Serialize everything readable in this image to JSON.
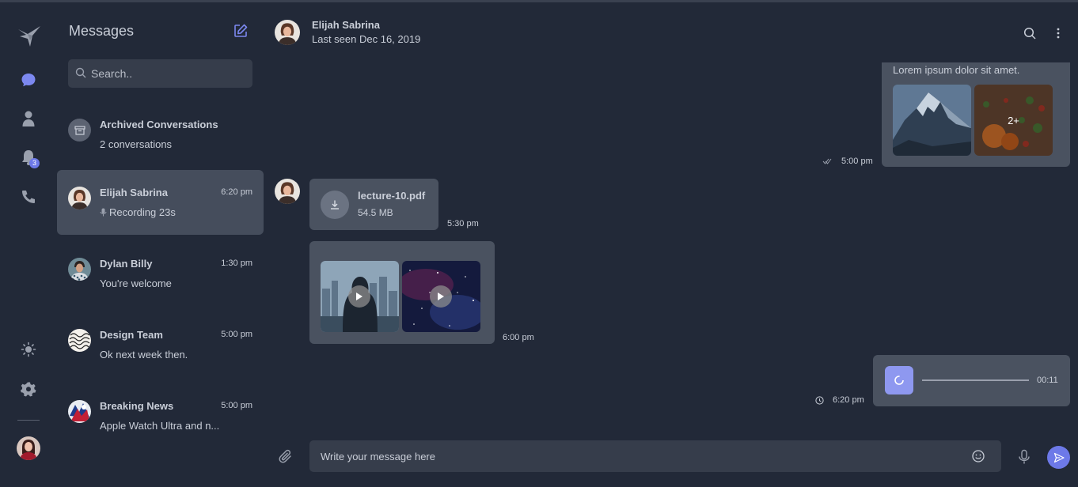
{
  "sidebar_nav": {
    "items": [
      {
        "name": "logo",
        "icon": "bird-logo-icon"
      },
      {
        "name": "chats",
        "icon": "chat-bubble-icon",
        "active": true
      },
      {
        "name": "contacts",
        "icon": "user-icon"
      },
      {
        "name": "notifications",
        "icon": "bell-icon",
        "badge": "3"
      },
      {
        "name": "calls",
        "icon": "phone-icon"
      },
      {
        "name": "theme",
        "icon": "sun-icon"
      },
      {
        "name": "settings",
        "icon": "gear-icon"
      }
    ],
    "notification_badge": "3"
  },
  "conversation_list": {
    "title": "Messages",
    "search_placeholder": "Search..",
    "archived": {
      "title": "Archived Conversations",
      "subtitle": "2 conversations"
    },
    "conversations": [
      {
        "name": "Elijah Sabrina",
        "time": "6:20 pm",
        "preview": "Recording 23s",
        "active": true
      },
      {
        "name": "Dylan Billy",
        "time": "1:30 pm",
        "preview": "You're welcome"
      },
      {
        "name": "Design Team",
        "time": "5:00 pm",
        "preview": "Ok next week then."
      },
      {
        "name": "Breaking News",
        "time": "5:00 pm",
        "preview": "Apple Watch Ultra and n..."
      }
    ]
  },
  "chat_header": {
    "name": "Elijah Sabrina",
    "status": "Last seen Dec 16, 2019"
  },
  "messages": {
    "m1": {
      "text": "Lorem ipsum dolor sit amet.",
      "more_label": "2+",
      "time": "5:00 pm"
    },
    "m2": {
      "file_name": "lecture-10.pdf",
      "file_size": "54.5 MB",
      "time": "5:30 pm"
    },
    "m3": {
      "time": "6:00 pm"
    },
    "m4": {
      "duration": "00:11",
      "time": "6:20 pm"
    }
  },
  "composer": {
    "placeholder": "Write your message here"
  },
  "colors": {
    "background": "#222938",
    "accent": "#6d79e8",
    "bubble": "#4a5260",
    "input": "#363d4b"
  }
}
